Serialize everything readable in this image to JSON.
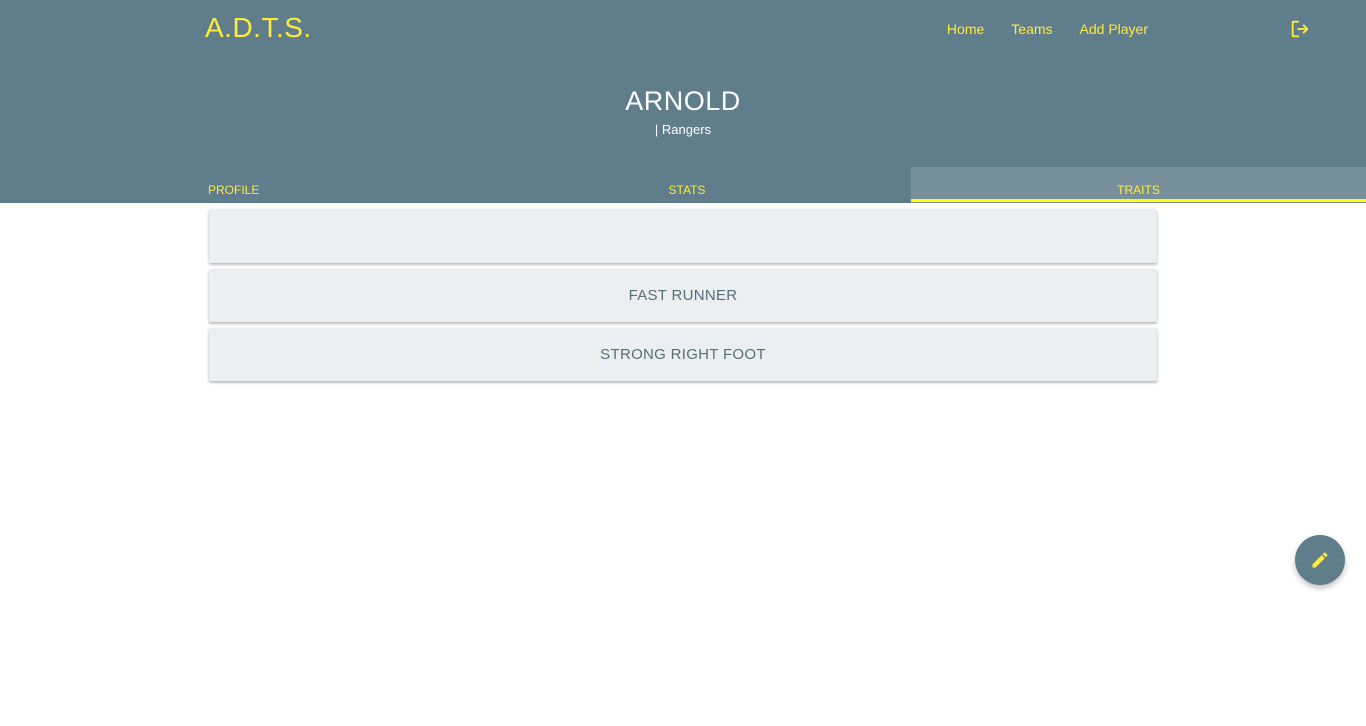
{
  "navbar": {
    "brand": "A.D.T.S.",
    "links": [
      {
        "label": "Home"
      },
      {
        "label": "Teams"
      },
      {
        "label": "Add Player"
      }
    ],
    "logout_icon": "logout-icon"
  },
  "player": {
    "name": "ARNOLD",
    "team": "| Rangers"
  },
  "tabs": [
    {
      "label": "PROFILE",
      "active": false
    },
    {
      "label": "STATS",
      "active": false
    },
    {
      "label": "TRAITS",
      "active": true
    }
  ],
  "traits": [
    "",
    "FAST RUNNER",
    "STRONG RIGHT FOOT"
  ],
  "fab": {
    "icon": "pencil-icon"
  },
  "colors": {
    "primary": "#607d8b",
    "accent": "#ffeb3b",
    "active_tab": "#78909c",
    "indicator": "#ffff00",
    "card": "#eceff1",
    "card_text": "#546e7a"
  }
}
